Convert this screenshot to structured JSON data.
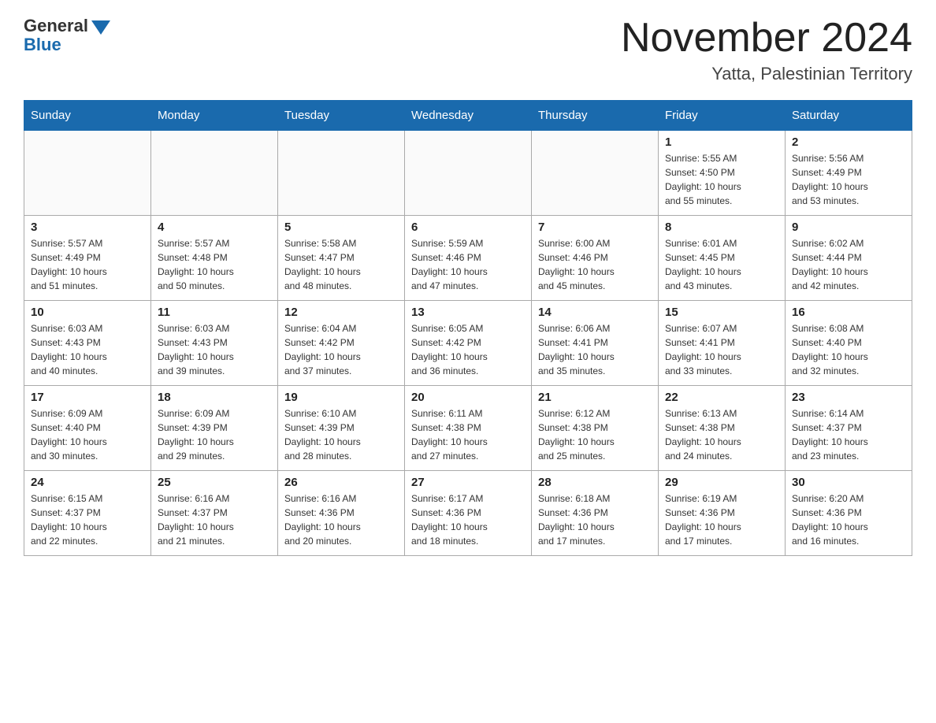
{
  "header": {
    "logo_general": "General",
    "logo_blue": "Blue",
    "month_title": "November 2024",
    "location": "Yatta, Palestinian Territory"
  },
  "days_of_week": [
    "Sunday",
    "Monday",
    "Tuesday",
    "Wednesday",
    "Thursday",
    "Friday",
    "Saturday"
  ],
  "weeks": [
    {
      "days": [
        {
          "number": "",
          "info": ""
        },
        {
          "number": "",
          "info": ""
        },
        {
          "number": "",
          "info": ""
        },
        {
          "number": "",
          "info": ""
        },
        {
          "number": "",
          "info": ""
        },
        {
          "number": "1",
          "info": "Sunrise: 5:55 AM\nSunset: 4:50 PM\nDaylight: 10 hours\nand 55 minutes."
        },
        {
          "number": "2",
          "info": "Sunrise: 5:56 AM\nSunset: 4:49 PM\nDaylight: 10 hours\nand 53 minutes."
        }
      ]
    },
    {
      "days": [
        {
          "number": "3",
          "info": "Sunrise: 5:57 AM\nSunset: 4:49 PM\nDaylight: 10 hours\nand 51 minutes."
        },
        {
          "number": "4",
          "info": "Sunrise: 5:57 AM\nSunset: 4:48 PM\nDaylight: 10 hours\nand 50 minutes."
        },
        {
          "number": "5",
          "info": "Sunrise: 5:58 AM\nSunset: 4:47 PM\nDaylight: 10 hours\nand 48 minutes."
        },
        {
          "number": "6",
          "info": "Sunrise: 5:59 AM\nSunset: 4:46 PM\nDaylight: 10 hours\nand 47 minutes."
        },
        {
          "number": "7",
          "info": "Sunrise: 6:00 AM\nSunset: 4:46 PM\nDaylight: 10 hours\nand 45 minutes."
        },
        {
          "number": "8",
          "info": "Sunrise: 6:01 AM\nSunset: 4:45 PM\nDaylight: 10 hours\nand 43 minutes."
        },
        {
          "number": "9",
          "info": "Sunrise: 6:02 AM\nSunset: 4:44 PM\nDaylight: 10 hours\nand 42 minutes."
        }
      ]
    },
    {
      "days": [
        {
          "number": "10",
          "info": "Sunrise: 6:03 AM\nSunset: 4:43 PM\nDaylight: 10 hours\nand 40 minutes."
        },
        {
          "number": "11",
          "info": "Sunrise: 6:03 AM\nSunset: 4:43 PM\nDaylight: 10 hours\nand 39 minutes."
        },
        {
          "number": "12",
          "info": "Sunrise: 6:04 AM\nSunset: 4:42 PM\nDaylight: 10 hours\nand 37 minutes."
        },
        {
          "number": "13",
          "info": "Sunrise: 6:05 AM\nSunset: 4:42 PM\nDaylight: 10 hours\nand 36 minutes."
        },
        {
          "number": "14",
          "info": "Sunrise: 6:06 AM\nSunset: 4:41 PM\nDaylight: 10 hours\nand 35 minutes."
        },
        {
          "number": "15",
          "info": "Sunrise: 6:07 AM\nSunset: 4:41 PM\nDaylight: 10 hours\nand 33 minutes."
        },
        {
          "number": "16",
          "info": "Sunrise: 6:08 AM\nSunset: 4:40 PM\nDaylight: 10 hours\nand 32 minutes."
        }
      ]
    },
    {
      "days": [
        {
          "number": "17",
          "info": "Sunrise: 6:09 AM\nSunset: 4:40 PM\nDaylight: 10 hours\nand 30 minutes."
        },
        {
          "number": "18",
          "info": "Sunrise: 6:09 AM\nSunset: 4:39 PM\nDaylight: 10 hours\nand 29 minutes."
        },
        {
          "number": "19",
          "info": "Sunrise: 6:10 AM\nSunset: 4:39 PM\nDaylight: 10 hours\nand 28 minutes."
        },
        {
          "number": "20",
          "info": "Sunrise: 6:11 AM\nSunset: 4:38 PM\nDaylight: 10 hours\nand 27 minutes."
        },
        {
          "number": "21",
          "info": "Sunrise: 6:12 AM\nSunset: 4:38 PM\nDaylight: 10 hours\nand 25 minutes."
        },
        {
          "number": "22",
          "info": "Sunrise: 6:13 AM\nSunset: 4:38 PM\nDaylight: 10 hours\nand 24 minutes."
        },
        {
          "number": "23",
          "info": "Sunrise: 6:14 AM\nSunset: 4:37 PM\nDaylight: 10 hours\nand 23 minutes."
        }
      ]
    },
    {
      "days": [
        {
          "number": "24",
          "info": "Sunrise: 6:15 AM\nSunset: 4:37 PM\nDaylight: 10 hours\nand 22 minutes."
        },
        {
          "number": "25",
          "info": "Sunrise: 6:16 AM\nSunset: 4:37 PM\nDaylight: 10 hours\nand 21 minutes."
        },
        {
          "number": "26",
          "info": "Sunrise: 6:16 AM\nSunset: 4:36 PM\nDaylight: 10 hours\nand 20 minutes."
        },
        {
          "number": "27",
          "info": "Sunrise: 6:17 AM\nSunset: 4:36 PM\nDaylight: 10 hours\nand 18 minutes."
        },
        {
          "number": "28",
          "info": "Sunrise: 6:18 AM\nSunset: 4:36 PM\nDaylight: 10 hours\nand 17 minutes."
        },
        {
          "number": "29",
          "info": "Sunrise: 6:19 AM\nSunset: 4:36 PM\nDaylight: 10 hours\nand 17 minutes."
        },
        {
          "number": "30",
          "info": "Sunrise: 6:20 AM\nSunset: 4:36 PM\nDaylight: 10 hours\nand 16 minutes."
        }
      ]
    }
  ]
}
